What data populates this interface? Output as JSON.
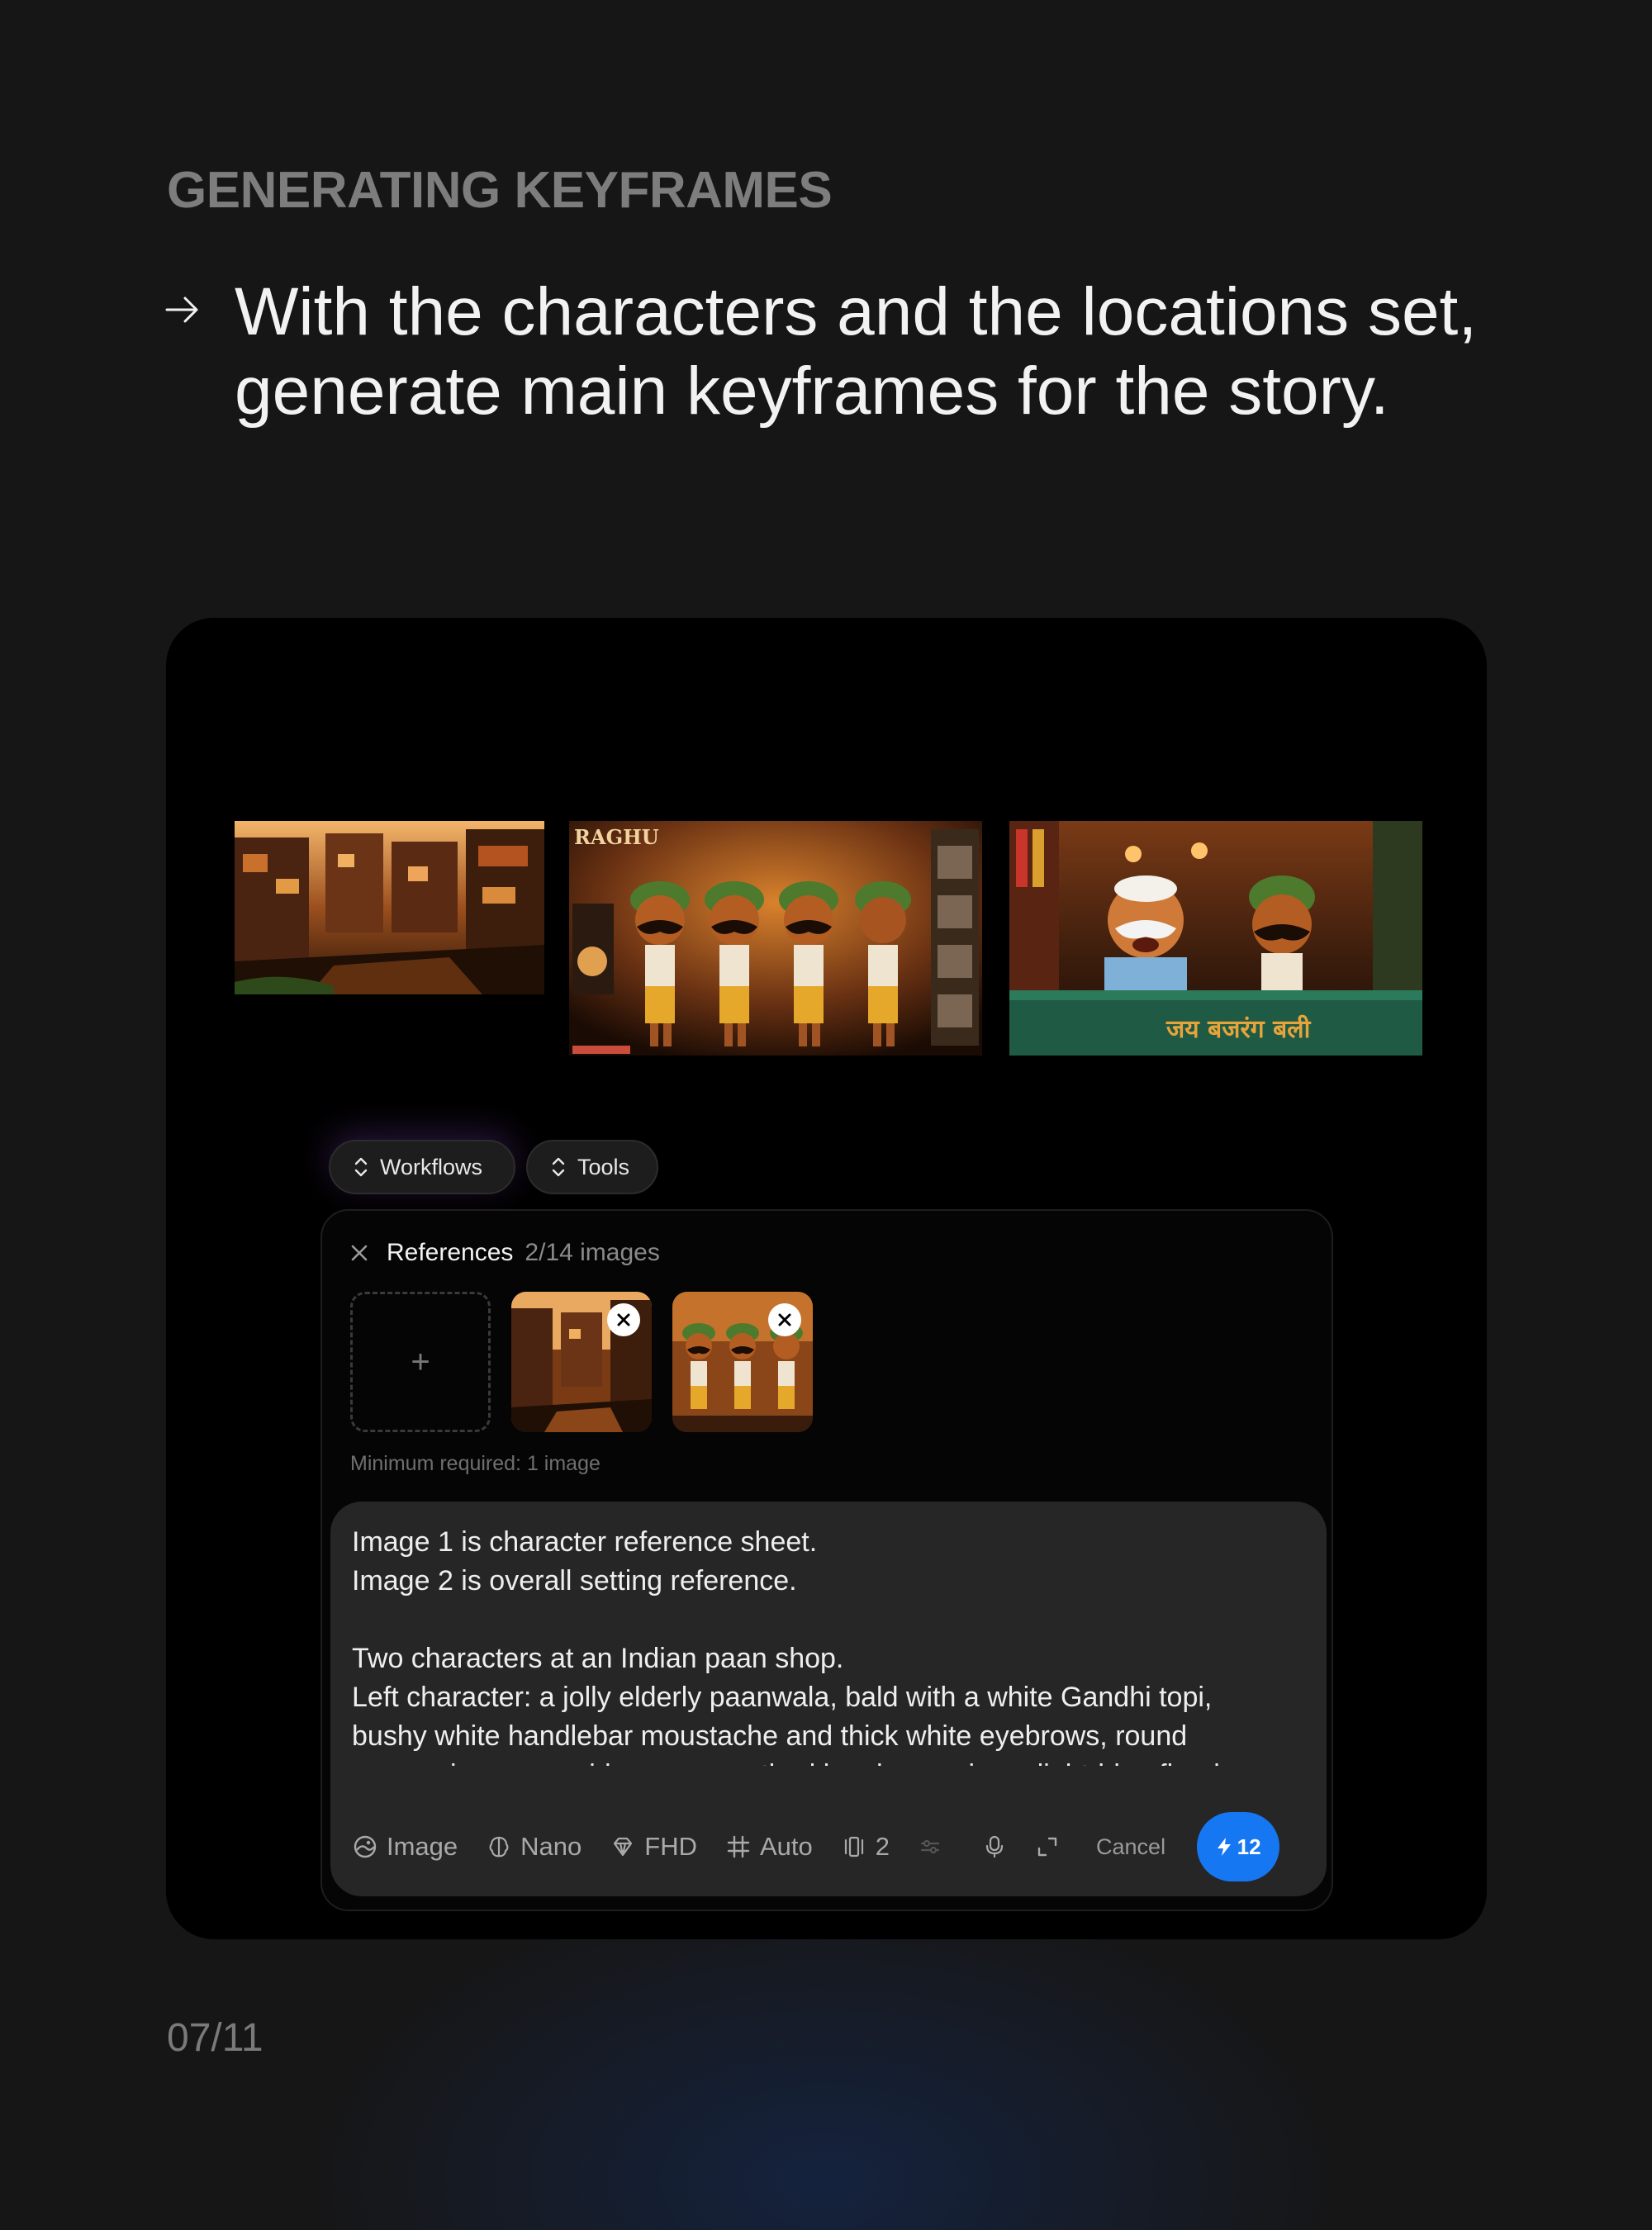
{
  "slide": {
    "eyebrow": "GENERATING KEYFRAMES",
    "headline": "With the characters and the locations set,\ngenerate main keyframes for the story.",
    "page_number": "07/11"
  },
  "app": {
    "gallery": [
      {
        "name": "street-scene",
        "caption": ""
      },
      {
        "name": "character-reference-sheet",
        "caption": "RAGHU"
      },
      {
        "name": "paan-shop-scene",
        "caption": "जय बजरंग बली"
      }
    ],
    "pills": {
      "workflows": "Workflows",
      "tools": "Tools"
    },
    "references": {
      "title": "References",
      "count": "2/14 images",
      "add_symbol": "+",
      "minimum_note": "Minimum required: 1 image"
    },
    "prompt_lines": [
      "Image 1 is character reference sheet.",
      "Image 2 is overall setting reference.",
      "",
      "Two characters at an Indian paan shop.",
      "Left character: a jolly elderly paanwala, bald with a white Gandhi topi,",
      "bushy white handlebar moustache and thick white eyebrows, round",
      "expressive eyes, wide open-mouthed laugh, wearing a light-blue floral"
    ],
    "toolbar": {
      "image": "Image",
      "model": "Nano",
      "quality": "FHD",
      "aspect": "Auto",
      "count": "2",
      "cancel": "Cancel",
      "credits": "12"
    },
    "accent_color": "#1677f2"
  }
}
